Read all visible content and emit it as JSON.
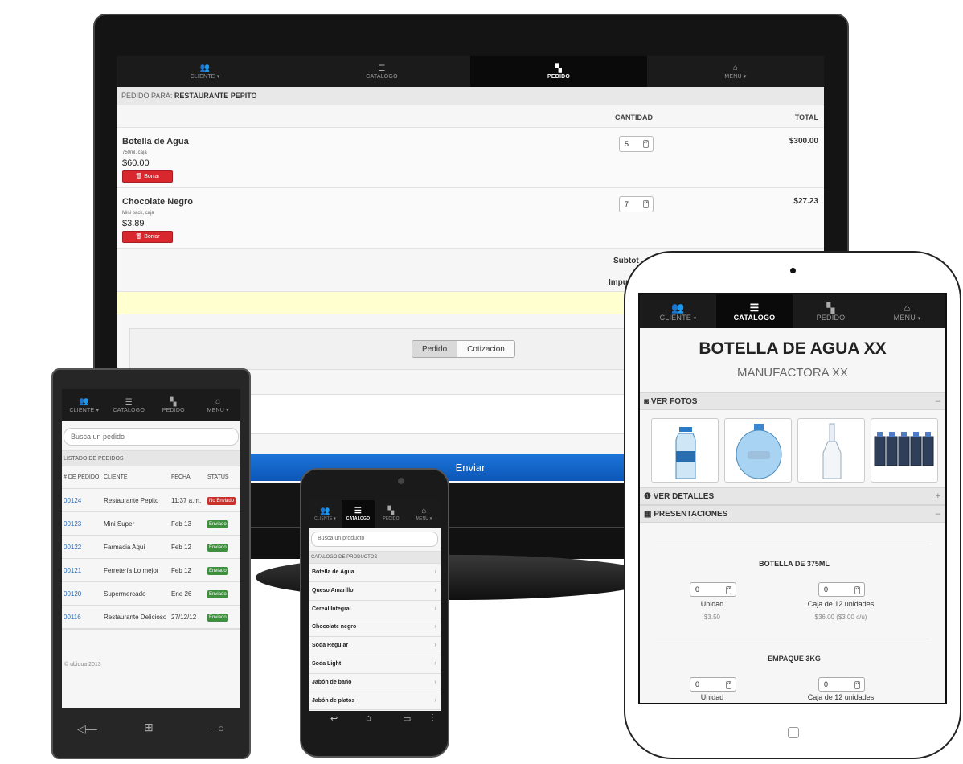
{
  "desktop": {
    "nav": [
      {
        "label": "CLIENTE",
        "icon": "users-icon",
        "caret": true
      },
      {
        "label": "CATALOGO",
        "icon": "list-icon",
        "caret": false
      },
      {
        "label": "PEDIDO",
        "icon": "cart-icon",
        "caret": false,
        "active": true
      },
      {
        "label": "MENU",
        "icon": "home-icon",
        "caret": true
      }
    ],
    "pedido_label": "PEDIDO PARA:",
    "pedido_client": "RESTAURANTE PEPITO",
    "col_cantidad": "CANTIDAD",
    "col_total": "TOTAL",
    "items": [
      {
        "name": "Botella de Agua",
        "desc": "750ml, caja",
        "price": "$60.00",
        "qty": "5",
        "total": "$300.00",
        "delete": "Borrar"
      },
      {
        "name": "Chocolate Negro",
        "desc": "Mini pack, caja",
        "price": "$3.89",
        "qty": "7",
        "total": "$27.23",
        "delete": "Borrar"
      }
    ],
    "subtotal_label": "Subtot",
    "impuesto_label": "Impu",
    "seg": [
      "Pedido",
      "Cotizacion"
    ],
    "send": "Enviar"
  },
  "winphone": {
    "nav": [
      {
        "label": "CLIENTE",
        "caret": true
      },
      {
        "label": "CATALOGO"
      },
      {
        "label": "PEDIDO"
      },
      {
        "label": "MENU",
        "caret": true
      }
    ],
    "search_placeholder": "Busca un pedido",
    "section": "LISTADO DE PEDIDOS",
    "headers": [
      "# DE PEDIDO",
      "CLIENTE",
      "FECHA",
      "STATUS"
    ],
    "rows": [
      {
        "id": "00124",
        "client": "Restaurante Pepito",
        "date": "11:37 a.m.",
        "status": "No Enviado",
        "color": "#c9302c"
      },
      {
        "id": "00123",
        "client": "Mini Super",
        "date": "Feb 13",
        "status": "Enviado",
        "color": "#3e8f3e"
      },
      {
        "id": "00122",
        "client": "Farmacia Aquí",
        "date": "Feb 12",
        "status": "Enviado",
        "color": "#3e8f3e"
      },
      {
        "id": "00121",
        "client": "Ferretería Lo mejor",
        "date": "Feb 12",
        "status": "Enviado",
        "color": "#3e8f3e"
      },
      {
        "id": "00120",
        "client": "Supermercado",
        "date": "Ene 26",
        "status": "Enviado",
        "color": "#3e8f3e"
      },
      {
        "id": "00116",
        "client": "Restaurante Delicioso",
        "date": "27/12/12",
        "status": "Enviado",
        "color": "#3e8f3e"
      }
    ],
    "footer": "© ubiqua 2013"
  },
  "android": {
    "nav": [
      {
        "label": "CLIENTE",
        "caret": true
      },
      {
        "label": "CATALOGO",
        "active": true
      },
      {
        "label": "PEDIDO"
      },
      {
        "label": "MENU",
        "caret": true
      }
    ],
    "search_placeholder": "Busca un producto",
    "section": "CATALOGO DE PRODUCTOS",
    "items": [
      "Botella de Agua",
      "Queso Amarillo",
      "Cereal Integral",
      "Chocolate negro",
      "Soda Regular",
      "Soda Light",
      "Jabón de baño",
      "Jabón de platos"
    ]
  },
  "tablet": {
    "nav": [
      {
        "label": "CLIENTE",
        "caret": true
      },
      {
        "label": "CATALOGO",
        "active": true
      },
      {
        "label": "PEDIDO"
      },
      {
        "label": "MENU",
        "caret": true
      }
    ],
    "title": "BOTELLA DE AGUA XX",
    "subtitle": "MANUFACTORA XX",
    "ver_fotos": "VER FOTOS",
    "ver_detalles": "VER DETALLES",
    "presentaciones": "PRESENTACIONES",
    "pres": [
      {
        "title": "BOTELLA DE 375ML",
        "unit_qty": "0",
        "unit_label": "Unidad",
        "unit_price": "$3.50",
        "box_qty": "0",
        "box_label": "Caja de 12 unidades",
        "box_price": "$36.00 ($3.00 c/u)"
      },
      {
        "title": "EMPAQUE 3KG",
        "unit_qty": "0",
        "unit_label": "Unidad",
        "box_qty": "0",
        "box_label": "Caja de 12 unidades"
      }
    ]
  }
}
